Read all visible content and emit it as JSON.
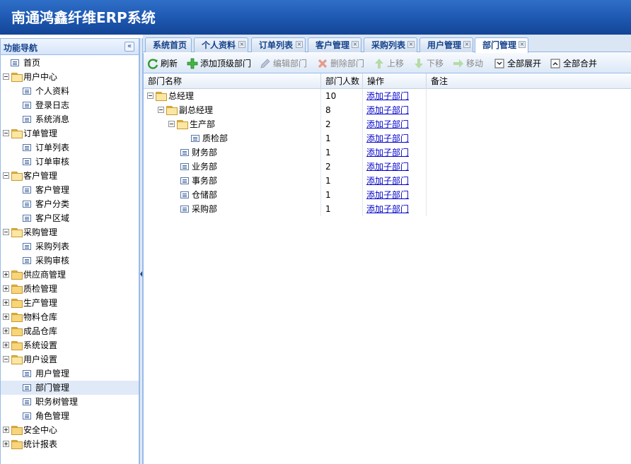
{
  "app": {
    "title": "南通鸿鑫纤维ERP系统"
  },
  "sidebar": {
    "title": "功能导航",
    "collapse_icon": "double-chevron-left-icon",
    "nodes": [
      {
        "label": "首页",
        "level": 0,
        "type": "leaf"
      },
      {
        "label": "用户中心",
        "level": 0,
        "type": "folder-open"
      },
      {
        "label": "个人资料",
        "level": 1,
        "type": "leaf"
      },
      {
        "label": "登录日志",
        "level": 1,
        "type": "leaf"
      },
      {
        "label": "系统消息",
        "level": 1,
        "type": "leaf"
      },
      {
        "label": "订单管理",
        "level": 0,
        "type": "folder-open"
      },
      {
        "label": "订单列表",
        "level": 1,
        "type": "leaf"
      },
      {
        "label": "订单审核",
        "level": 1,
        "type": "leaf"
      },
      {
        "label": "客户管理",
        "level": 0,
        "type": "folder-open"
      },
      {
        "label": "客户管理",
        "level": 1,
        "type": "leaf"
      },
      {
        "label": "客户分类",
        "level": 1,
        "type": "leaf"
      },
      {
        "label": "客户区域",
        "level": 1,
        "type": "leaf"
      },
      {
        "label": "采购管理",
        "level": 0,
        "type": "folder-open"
      },
      {
        "label": "采购列表",
        "level": 1,
        "type": "leaf"
      },
      {
        "label": "采购审核",
        "level": 1,
        "type": "leaf"
      },
      {
        "label": "供应商管理",
        "level": 0,
        "type": "folder-closed"
      },
      {
        "label": "质检管理",
        "level": 0,
        "type": "folder-closed"
      },
      {
        "label": "生产管理",
        "level": 0,
        "type": "folder-closed"
      },
      {
        "label": "物料仓库",
        "level": 0,
        "type": "folder-closed"
      },
      {
        "label": "成品仓库",
        "level": 0,
        "type": "folder-closed"
      },
      {
        "label": "系统设置",
        "level": 0,
        "type": "folder-closed"
      },
      {
        "label": "用户设置",
        "level": 0,
        "type": "folder-open"
      },
      {
        "label": "用户管理",
        "level": 1,
        "type": "leaf"
      },
      {
        "label": "部门管理",
        "level": 1,
        "type": "leaf",
        "selected": true
      },
      {
        "label": "职务树管理",
        "level": 1,
        "type": "leaf"
      },
      {
        "label": "角色管理",
        "level": 1,
        "type": "leaf"
      },
      {
        "label": "安全中心",
        "level": 0,
        "type": "folder-closed"
      },
      {
        "label": "统计报表",
        "level": 0,
        "type": "folder-closed"
      }
    ]
  },
  "tabs": [
    {
      "label": "系统首页",
      "closable": false
    },
    {
      "label": "个人资料",
      "closable": true
    },
    {
      "label": "订单列表",
      "closable": true
    },
    {
      "label": "客户管理",
      "closable": true
    },
    {
      "label": "采购列表",
      "closable": true
    },
    {
      "label": "用户管理",
      "closable": true
    },
    {
      "label": "部门管理",
      "closable": true,
      "active": true
    }
  ],
  "toolbar": {
    "refresh": "刷新",
    "add_top": "添加顶级部门",
    "edit": "编辑部门",
    "delete": "删除部门",
    "move_up": "上移",
    "move_down": "下移",
    "move": "移动",
    "expand_all": "全部展开",
    "collapse_all": "全部合并"
  },
  "grid": {
    "columns": [
      "部门名称",
      "部门人数",
      "操作",
      "备注"
    ],
    "rows": [
      {
        "name": "总经理",
        "level": 0,
        "type": "folder-open",
        "count": "10",
        "action": "添加子部门",
        "note": ""
      },
      {
        "name": "副总经理",
        "level": 1,
        "type": "folder-open",
        "count": "8",
        "action": "添加子部门",
        "note": ""
      },
      {
        "name": "生产部",
        "level": 2,
        "type": "folder-open",
        "count": "2",
        "action": "添加子部门",
        "note": ""
      },
      {
        "name": "质检部",
        "level": 3,
        "type": "leaf",
        "count": "1",
        "action": "添加子部门",
        "note": ""
      },
      {
        "name": "财务部",
        "level": 2,
        "type": "leaf",
        "count": "1",
        "action": "添加子部门",
        "note": ""
      },
      {
        "name": "业务部",
        "level": 2,
        "type": "leaf",
        "count": "2",
        "action": "添加子部门",
        "note": ""
      },
      {
        "name": "事务部",
        "level": 2,
        "type": "leaf",
        "count": "1",
        "action": "添加子部门",
        "note": ""
      },
      {
        "name": "仓储部",
        "level": 2,
        "type": "leaf",
        "count": "1",
        "action": "添加子部门",
        "note": ""
      },
      {
        "name": "采购部",
        "level": 2,
        "type": "leaf",
        "count": "1",
        "action": "添加子部门",
        "note": ""
      }
    ]
  },
  "colors": {
    "header": "#1d57b0",
    "link": "#0000cc",
    "accent": "#15428b"
  }
}
